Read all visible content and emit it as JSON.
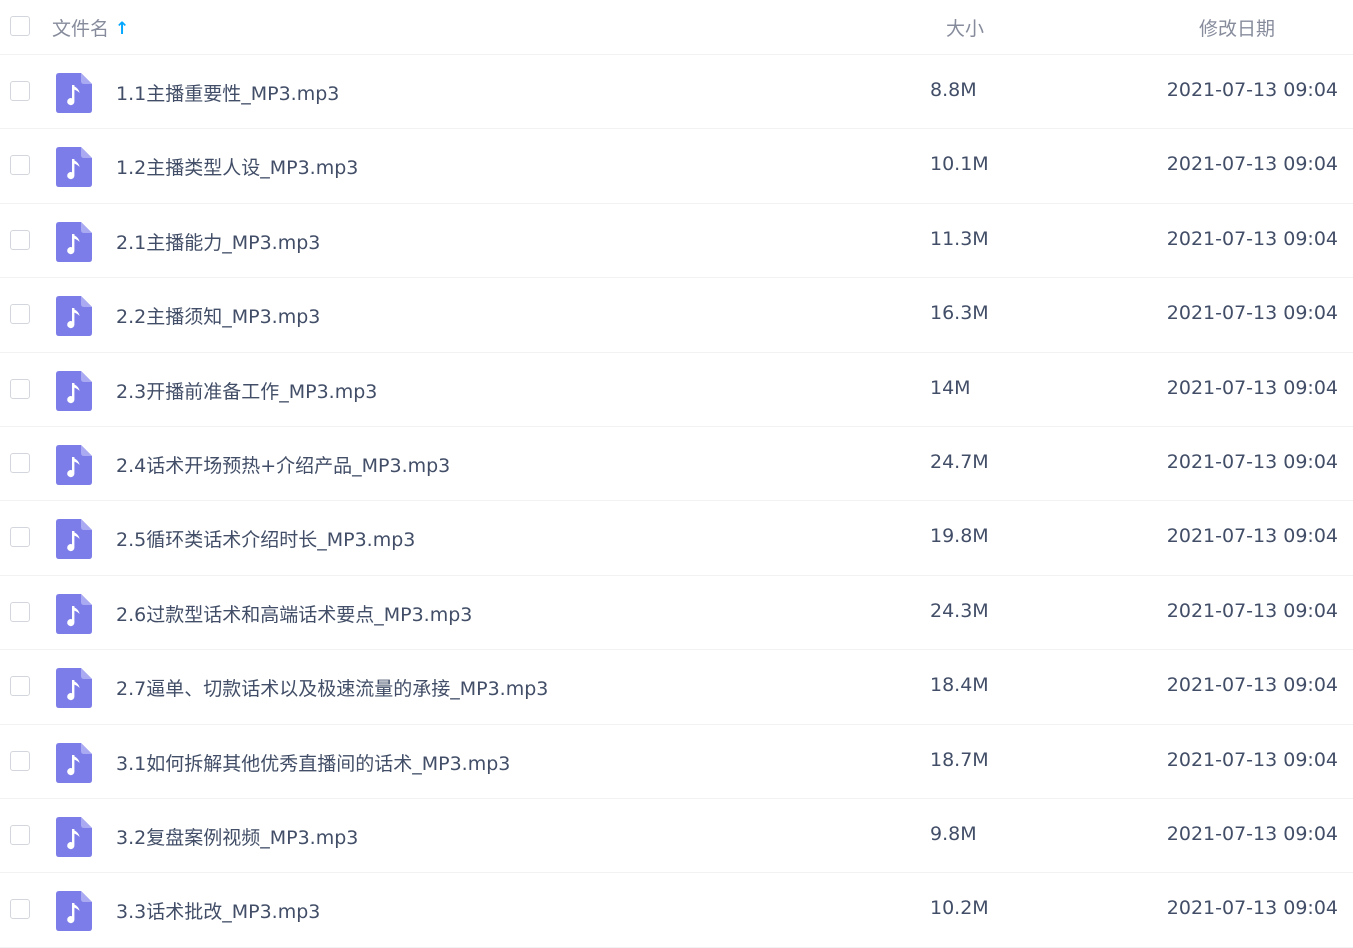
{
  "header": {
    "name_label": "文件名",
    "sort_arrow": "↑",
    "size_label": "大小",
    "date_label": "修改日期"
  },
  "icon": {
    "type": "music-file-icon",
    "color": "#7c7de8"
  },
  "files": [
    {
      "name": "1.1主播重要性_MP3.mp3",
      "size": "8.8M",
      "modified": "2021-07-13 09:04"
    },
    {
      "name": "1.2主播类型人设_MP3.mp3",
      "size": "10.1M",
      "modified": "2021-07-13 09:04"
    },
    {
      "name": "2.1主播能力_MP3.mp3",
      "size": "11.3M",
      "modified": "2021-07-13 09:04"
    },
    {
      "name": "2.2主播须知_MP3.mp3",
      "size": "16.3M",
      "modified": "2021-07-13 09:04"
    },
    {
      "name": "2.3开播前准备工作_MP3.mp3",
      "size": "14M",
      "modified": "2021-07-13 09:04"
    },
    {
      "name": "2.4话术开场预热+介绍产品_MP3.mp3",
      "size": "24.7M",
      "modified": "2021-07-13 09:04"
    },
    {
      "name": "2.5循环类话术介绍时长_MP3.mp3",
      "size": "19.8M",
      "modified": "2021-07-13 09:04"
    },
    {
      "name": "2.6过款型话术和高端话术要点_MP3.mp3",
      "size": "24.3M",
      "modified": "2021-07-13 09:04"
    },
    {
      "name": "2.7逼单、切款话术以及极速流量的承接_MP3.mp3",
      "size": "18.4M",
      "modified": "2021-07-13 09:04"
    },
    {
      "name": "3.1如何拆解其他优秀直播间的话术_MP3.mp3",
      "size": "18.7M",
      "modified": "2021-07-13 09:04"
    },
    {
      "name": "3.2复盘案例视频_MP3.mp3",
      "size": "9.8M",
      "modified": "2021-07-13 09:04"
    },
    {
      "name": "3.3话术批改_MP3.mp3",
      "size": "10.2M",
      "modified": "2021-07-13 09:04"
    }
  ]
}
